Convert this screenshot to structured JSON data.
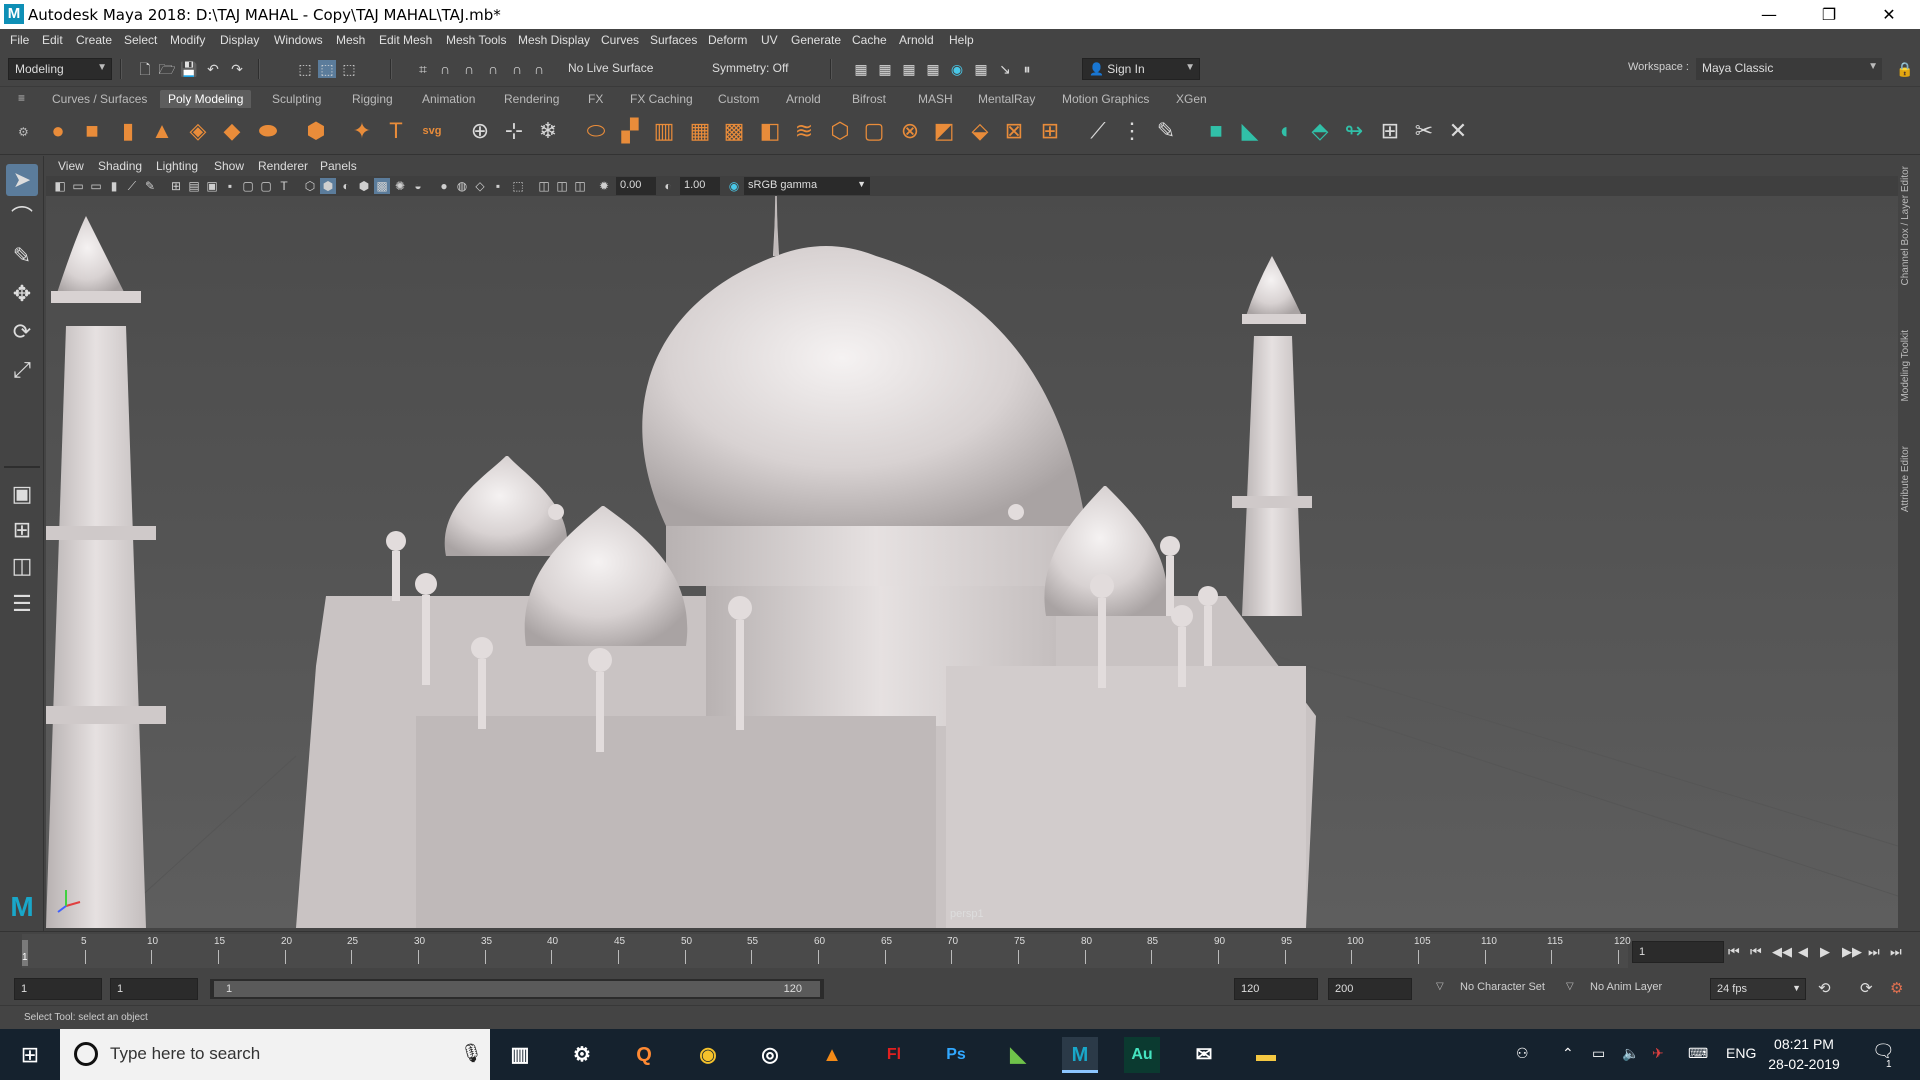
{
  "titlebar": {
    "app_icon": "M",
    "title": "Autodesk Maya 2018: D:\\TAJ MAHAL - Copy\\TAJ MAHAL\\TAJ.mb*",
    "minimize": "—",
    "restore": "❐",
    "close": "✕"
  },
  "menubar": [
    "File",
    "Edit",
    "Create",
    "Select",
    "Modify",
    "Display",
    "Windows",
    "Mesh",
    "Edit Mesh",
    "Mesh Tools",
    "Mesh Display",
    "Curves",
    "Surfaces",
    "Deform",
    "UV",
    "Generate",
    "Cache",
    "Arnold",
    "Help"
  ],
  "status": {
    "mode": "Modeling",
    "live_surface": "No Live Surface",
    "symmetry": "Symmetry: Off",
    "sign_in": "Sign In",
    "workspace_label": "Workspace :",
    "workspace": "Maya Classic"
  },
  "shelf_tabs": [
    "Curves / Surfaces",
    "Poly Modeling",
    "Sculpting",
    "Rigging",
    "Animation",
    "Rendering",
    "FX",
    "FX Caching",
    "Custom",
    "Arnold",
    "Bifrost",
    "MASH",
    "MentalRay",
    "Motion Graphics",
    "XGen"
  ],
  "shelf_active": "Poly Modeling",
  "shelf_svg_label": "svg",
  "shelf_text_label": "T",
  "panel_menu": [
    "View",
    "Shading",
    "Lighting",
    "Show",
    "Renderer",
    "Panels"
  ],
  "panel_toolbar": {
    "exposure": "0.00",
    "gamma": "1.00",
    "color_space": "sRGB gamma"
  },
  "side_tabs": [
    "Channel Box / Layer Editor",
    "Modeling Toolkit",
    "Attribute Editor"
  ],
  "viewport": {
    "camera": "persp1"
  },
  "timeline": {
    "labels": [
      "5",
      "10",
      "15",
      "20",
      "25",
      "30",
      "35",
      "40",
      "45",
      "50",
      "55",
      "60",
      "65",
      "70",
      "75",
      "80",
      "85",
      "90",
      "95",
      "100",
      "105",
      "110",
      "115",
      "120"
    ],
    "current_frame_marker": "1",
    "current_frame": "1",
    "playback": [
      "⏮",
      "⏮",
      "◀◀",
      "◀",
      "▶",
      "▶▶",
      "⏭",
      "⏭"
    ]
  },
  "range": {
    "start": "1",
    "playback_start": "1",
    "slider_start": "1",
    "slider_end": "120",
    "playback_end": "120",
    "end": "200",
    "character_set": "No Character Set",
    "anim_layer": "No Anim Layer",
    "fps": "24 fps"
  },
  "helpline": "Select Tool: select an object",
  "taskbar": {
    "search_placeholder": "Type here to search",
    "apps": [
      "Task View",
      "Settings",
      "Q",
      "Chrome",
      "Media",
      "VLC",
      "Fl",
      "Ps",
      "Maya Cloth",
      "M",
      "Au",
      "Mail",
      "Explorer"
    ],
    "language": "ENG",
    "time": "08:21 PM",
    "date": "28-02-2019",
    "notifications": "1"
  }
}
